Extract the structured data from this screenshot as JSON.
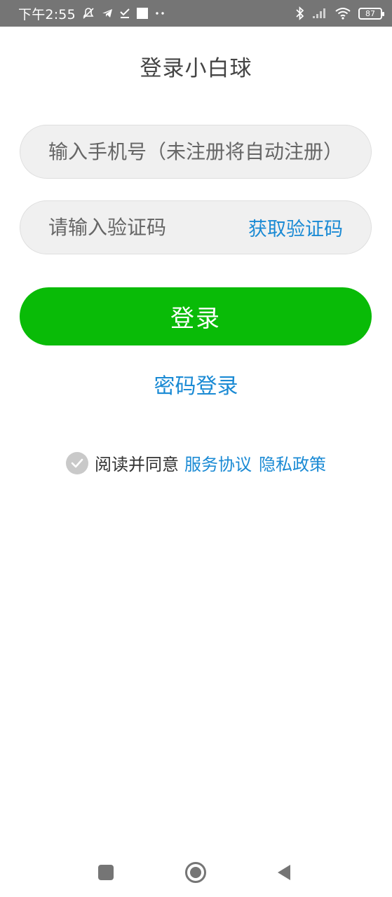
{
  "status_bar": {
    "time": "下午2:55",
    "battery": "87",
    "icons": [
      "mute-icon",
      "telegram-icon",
      "download-done-icon",
      "square-notification-icon",
      "more-dots-icon",
      "bluetooth-icon",
      "signal-icon",
      "wifi-icon",
      "battery-icon"
    ]
  },
  "header": {
    "title": "登录小白球"
  },
  "phone_field": {
    "placeholder": "输入手机号（未注册将自动注册）",
    "value": ""
  },
  "code_field": {
    "placeholder": "请输入验证码",
    "value": "",
    "get_code_label": "获取验证码"
  },
  "login_button": {
    "label": "登录"
  },
  "password_login": {
    "label": "密码登录"
  },
  "agreement": {
    "text": "阅读并同意",
    "service_link": "服务协议",
    "privacy_link": "隐私政策",
    "checked": false
  },
  "nav_bar": {
    "icons": [
      "recent-apps-icon",
      "home-icon",
      "back-icon"
    ]
  },
  "colors": {
    "accent_green": "#09bb07",
    "link_blue": "#1a8ad4",
    "status_bar_bg": "#757575",
    "input_bg": "#f0f0f0"
  }
}
